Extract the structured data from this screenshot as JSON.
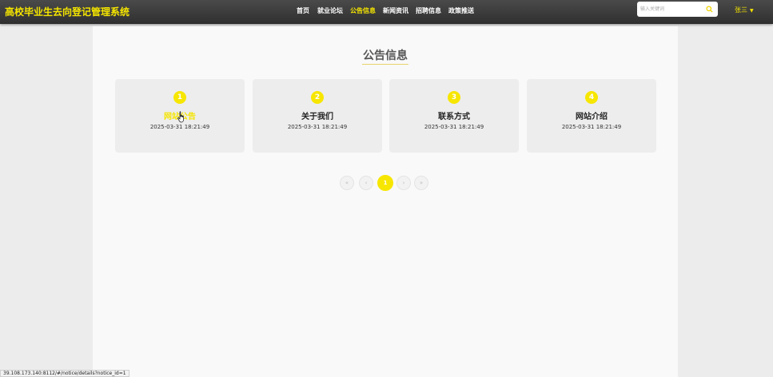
{
  "app": {
    "title": "高校毕业生去向登记管理系统"
  },
  "nav": {
    "items": [
      {
        "label": "首页"
      },
      {
        "label": "就业论坛"
      },
      {
        "label": "公告信息"
      },
      {
        "label": "新闻资讯"
      },
      {
        "label": "招聘信息"
      },
      {
        "label": "政策推送"
      }
    ],
    "active_index": 2
  },
  "search": {
    "placeholder": "输入关键词",
    "value": "",
    "icon": "search-icon"
  },
  "user": {
    "name": "张三",
    "icon": "caret-down-icon"
  },
  "section": {
    "title": "公告信息"
  },
  "cards": [
    {
      "number": "1",
      "title": "网站公告",
      "date": "2025-03-31 18:21:49"
    },
    {
      "number": "2",
      "title": "关于我们",
      "date": "2025-03-31 18:21:49"
    },
    {
      "number": "3",
      "title": "联系方式",
      "date": "2025-03-31 18:21:49"
    },
    {
      "number": "4",
      "title": "网站介绍",
      "date": "2025-03-31 18:21:49"
    }
  ],
  "pagination": {
    "first": "«",
    "prev": "‹",
    "current": "1",
    "next": "›",
    "last": "»"
  },
  "status_bar": {
    "url": "39.108.173.140:8112/#/notice/details?notice_id=1"
  },
  "colors": {
    "accent": "#f5e500",
    "topbar": "#3a3a3a",
    "card": "#ededed",
    "page_bg": "#f9f9f9"
  }
}
